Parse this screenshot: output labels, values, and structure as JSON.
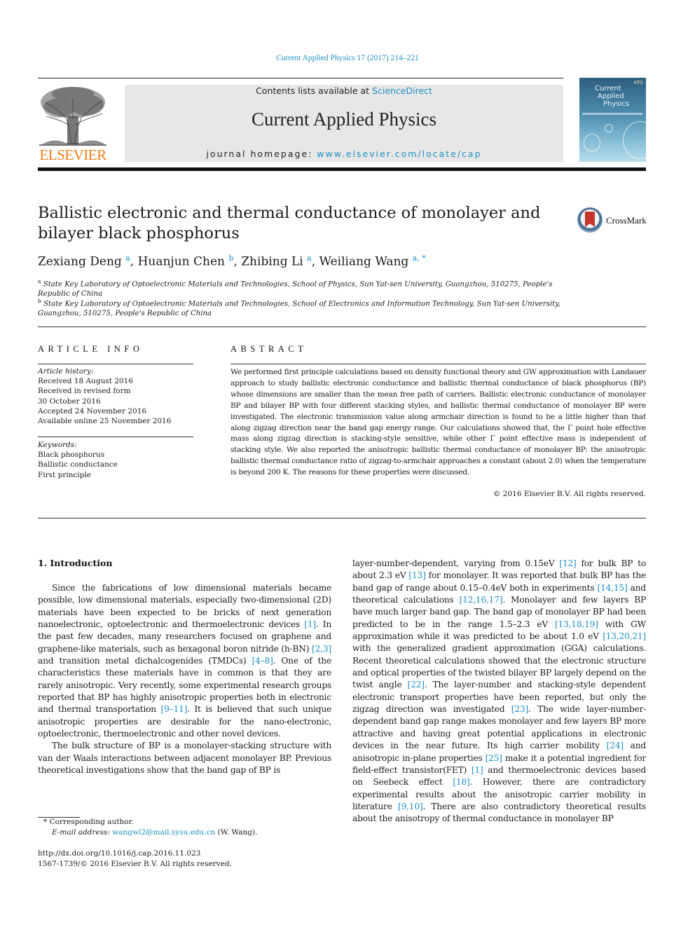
{
  "running_head": "Current Applied Physics 17 (2017) 214–221",
  "masthead": {
    "publisher_logo_text": "ELSEVIER",
    "contents_prefix": "Contents lists available at ",
    "contents_link": "ScienceDirect",
    "journal_title": "Current Applied Physics",
    "homepage_prefix": "journal homepage: ",
    "homepage_link": "www.elsevier.com/locate/cap",
    "cover": {
      "line1": "Current",
      "line2": "Applied",
      "line3": "Physics",
      "badge": "KPS"
    }
  },
  "crossmark_label": "CrossMark",
  "title": "Ballistic electronic and thermal conductance of monolayer and bilayer black phosphorus",
  "authors": [
    {
      "name": "Zexiang Deng",
      "sup": "a"
    },
    {
      "name": "Huanjun Chen",
      "sup": "b"
    },
    {
      "name": "Zhibing Li",
      "sup": "a"
    },
    {
      "name": "Weiliang Wang",
      "sup": "a, *"
    }
  ],
  "affiliations": [
    {
      "mark": "a",
      "text": "State Key Laboratory of Optoelectronic Materials and Technologies, School of Physics, Sun Yat-sen University, Guangzhou, 510275, People's Republic of China"
    },
    {
      "mark": "b",
      "text": "State Key Laboratory of Optoelectronic Materials and Technologies, School of Electronics and Information Technology, Sun Yat-sen University, Guangzhou, 510275, People's Republic of China"
    }
  ],
  "article_info": {
    "heading": "ARTICLE INFO",
    "history_label": "Article history:",
    "history": [
      "Received 18 August 2016",
      "Received in revised form",
      "30 October 2016",
      "Accepted 24 November 2016",
      "Available online 25 November 2016"
    ],
    "keywords_label": "Keywords:",
    "keywords": [
      "Black phosphorus",
      "Ballistic conductance",
      "First principle"
    ]
  },
  "abstract": {
    "heading": "ABSTRACT",
    "text": "We performed first principle calculations based on density functional theory and GW approximation with Landauer approach to study ballistic electronic conductance and ballistic thermal conductance of black phosphorus (BP) whose dimensions are smaller than the mean free path of carriers. Ballistic electronic conductance of monolayer BP and bilayer BP with four different stacking styles, and ballistic thermal conductance of monolayer BP were investigated. The electronic transmission value along armchair direction is found to be a little higher than that along zigzag direction near the band gap energy range. Our calculations showed that, the Γ point hole effective mass along zigzag direction is stacking-style sensitive, while other Γ point effective mass is independent of stacking style. We also reported the anisotropic ballistic thermal conductance of monolayer BP: the anisotropic ballistic thermal conductance ratio of zigzag-to-armchair approaches a constant (about 2.0) when the temperature is beyond 200 K. The reasons for these properties were discussed.",
    "copyright": "© 2016 Elsevier B.V. All rights reserved."
  },
  "intro": {
    "heading": "1.  Introduction",
    "left_paragraphs": [
      [
        {
          "t": "Since the fabrications of low dimensional materials became possible, low dimensional materials, especially two-dimensional (2D) materials have been expected to be bricks of next generation nanoelectronic, optoelectronic and thermoelectronic devices "
        },
        {
          "c": "[1]"
        },
        {
          "t": ". In the past few decades, many researchers focused on graphene and graphene-like materials, such as hexagonal boron nitride (h-BN) "
        },
        {
          "c": "[2,3]"
        },
        {
          "t": " and transition metal dichalcogenides (TMDCs) "
        },
        {
          "c": "[4–8]"
        },
        {
          "t": ". One of the characteristics these materials have in common is that they are rarely anisotropic. Very recently, some experimental research groups reported that BP has highly anisotropic properties both in electronic and thermal transportation "
        },
        {
          "c": "[9–11]"
        },
        {
          "t": ". It is believed that such unique anisotropic properties are desirable for the nano-electronic, optoelectronic, thermoelectronic and other novel devices."
        }
      ],
      [
        {
          "t": "The bulk structure of BP is a monolayer-stacking structure with van der Waals interactions between adjacent monolayer BP. Previous theoretical investigations show that the band gap of BP is"
        }
      ]
    ],
    "right_paragraph": [
      {
        "t": "layer-number-dependent, varying from 0.15eV "
      },
      {
        "c": "[12]"
      },
      {
        "t": " for bulk BP to about 2.3 eV "
      },
      {
        "c": "[13]"
      },
      {
        "t": " for monolayer. It was reported that bulk BP has the band gap of range about 0.15–0.4eV both in experiments "
      },
      {
        "c": "[14,15]"
      },
      {
        "t": " and theoretical calculations "
      },
      {
        "c": "[12,16,17]"
      },
      {
        "t": ". Monolayer and few layers BP have much larger band gap. The band gap of monolayer BP had been predicted to be in the range 1.5–2.3 eV "
      },
      {
        "c": "[13,18,19]"
      },
      {
        "t": " with GW approximation while it was predicted to be about 1.0 eV "
      },
      {
        "c": "[13,20,21]"
      },
      {
        "t": " with the generalized gradient approximation (GGA) calculations. Recent theoretical calculations showed that the electronic structure and optical properties of the twisted bilayer BP largely depend on the twist angle "
      },
      {
        "c": "[22]"
      },
      {
        "t": ". The layer-number and stacking-style dependent electronic transport properties have been reported, but only the zigzag direction was investigated "
      },
      {
        "c": "[23]"
      },
      {
        "t": ". The wide layer-number-dependent band gap range makes monolayer and few layers BP more attractive and having great potential applications in electronic devices in the near future. Its high carrier mobility "
      },
      {
        "c": "[24]"
      },
      {
        "t": " and anisotropic in-plane properties "
      },
      {
        "c": "[25]"
      },
      {
        "t": " make it a potential ingredient for field-effect transistor(FET) "
      },
      {
        "c": "[1]"
      },
      {
        "t": " and thermoelectronic devices based on Seebeck effect "
      },
      {
        "c": "[18]"
      },
      {
        "t": ". However, there are contradictory experimental results about the anisotropic carrier mobility in literature "
      },
      {
        "c": "[9,10]"
      },
      {
        "t": ". There are also contradictory theoretical results about the anisotropy of thermal conductance in monolayer BP"
      }
    ]
  },
  "footnotes": {
    "corresponding_mark": "*",
    "corresponding": "Corresponding author.",
    "email_label": "E-mail address: ",
    "email": "wangwl2@mail.sysu.edu.cn",
    "email_suffix": " (W. Wang).",
    "doi": "http://dx.doi.org/10.1016/j.cap.2016.11.023",
    "issn_line": "1567-1739/© 2016 Elsevier B.V. All rights reserved."
  }
}
